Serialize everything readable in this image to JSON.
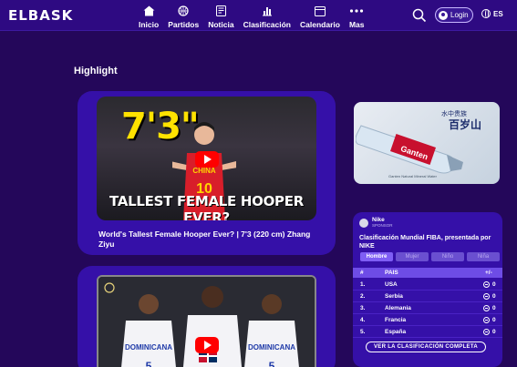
{
  "header": {
    "logo": "ELBASK",
    "nav": [
      {
        "label": "Inicio",
        "icon": "home-icon"
      },
      {
        "label": "Partidos",
        "icon": "basketball-icon"
      },
      {
        "label": "Noticia",
        "icon": "news-icon"
      },
      {
        "label": "Clasificación",
        "icon": "bar-chart-icon"
      },
      {
        "label": "Calendario",
        "icon": "calendar-icon"
      },
      {
        "label": "Mas",
        "icon": "more-icon"
      }
    ],
    "login_label": "Login",
    "language": "ES"
  },
  "main": {
    "section_title": "Highlight",
    "videos": [
      {
        "thumb_big_text": "7'3\"",
        "thumb_jersey": "CHINA",
        "thumb_jersey_number": "10",
        "thumb_caption": "TALLEST FEMALE HOOPER EVER?",
        "title": "World's Tallest Female Hooper Ever? | 7'3 (220 cm) Zhang Ziyu"
      },
      {
        "thumb_jersey_left": "DOMINICANA",
        "thumb_jersey_right": "DOMINICANA",
        "thumb_number_left": "5",
        "thumb_number_right": "5"
      }
    ]
  },
  "ad": {
    "cn_small": "水中贵族",
    "cn_big": "百岁山",
    "brand_label": "Ganten",
    "caption": "Ganten Natural Mineral Water"
  },
  "ranking_widget": {
    "sponsor_name": "Nike",
    "sponsor_tag": "SPONSOR",
    "title": "Clasificación Mundial FIBA, presentada por NIKE",
    "tabs": [
      "Hombre",
      "Mujer",
      "Niño",
      "Niña"
    ],
    "active_tab": "Hombre",
    "columns": {
      "rank": "#",
      "country": "PAIS",
      "change": "+/-"
    },
    "rows": [
      {
        "rank": "1.",
        "country": "USA",
        "change": "0"
      },
      {
        "rank": "2.",
        "country": "Serbia",
        "change": "0"
      },
      {
        "rank": "3.",
        "country": "Alemania",
        "change": "0"
      },
      {
        "rank": "4.",
        "country": "Francia",
        "change": "0"
      },
      {
        "rank": "5.",
        "country": "España",
        "change": "0"
      }
    ],
    "cta_label": "VER LA CLASIFICACIÓN COMPLETA"
  }
}
